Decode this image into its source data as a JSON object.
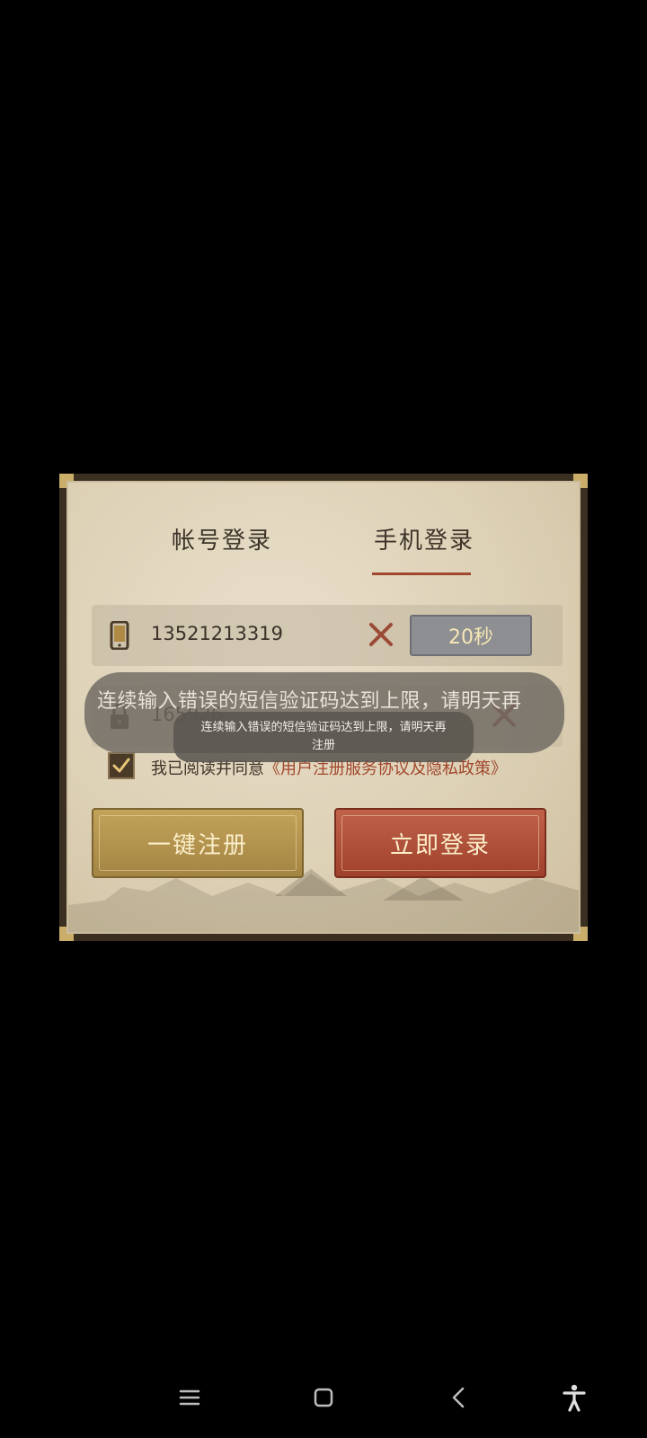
{
  "tabs": {
    "account_label": "帐号登录",
    "phone_label": "手机登录",
    "active": "phone"
  },
  "phone_row": {
    "icon": "phone-icon",
    "value": "13521213319",
    "clear_icon": "close-icon",
    "countdown_label": "20秒"
  },
  "code_row": {
    "icon": "lock-icon",
    "value": "165926",
    "partial_text": "注册",
    "clear_icon": "close-icon"
  },
  "agreement": {
    "checked": true,
    "prefix": "我已阅读并同意",
    "link": "《用户注册服务协议及隐私政策》"
  },
  "buttons": {
    "register_label": "一键注册",
    "login_label": "立即登录"
  },
  "toast_large": {
    "text": "连续输入错误的短信验证码达到上限，请明天再"
  },
  "toast_small": {
    "line1": "连续输入错误的短信验证码达到上限，请明天再",
    "line2": "注册"
  },
  "navbar": {
    "items": [
      "menu-icon",
      "home-icon",
      "back-icon",
      "accessibility-icon"
    ]
  },
  "colors": {
    "accent_red": "#a0472d",
    "gold_button": "#b39450",
    "red_button": "#b0533b",
    "countdown_gray": "#8e8f92"
  }
}
